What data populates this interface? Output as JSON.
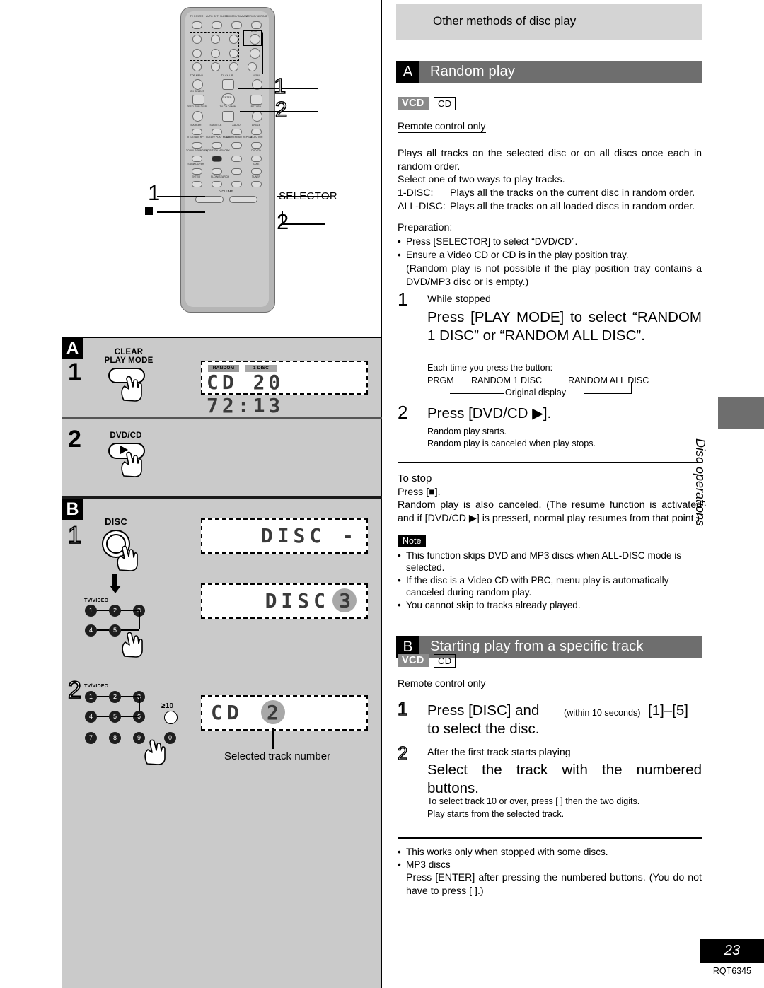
{
  "page": {
    "number": "23",
    "doc_code": "RQT6345",
    "side_tab_label": "Disc operations"
  },
  "right": {
    "banner": "Other methods of disc play",
    "section_a": {
      "letter": "A",
      "title": "Random play",
      "badges": {
        "vcd": "VCD",
        "cd": "CD"
      },
      "remote_only": "Remote control only",
      "intro1": "Plays all tracks on the selected disc or on all discs once each in random order.",
      "intro2": "Select one of two ways to play tracks.",
      "disc1_label": "1-DISC:",
      "disc1_text": "Plays all the tracks on the current disc in random order.",
      "discall_label": "ALL-DISC:",
      "discall_text": "Plays all the tracks on all loaded discs in random order.",
      "prep_title": "Preparation:",
      "prep_b1": "Press [SELECTOR] to select “DVD/CD”.",
      "prep_b2": "Ensure a Video CD or CD is in the play position tray.",
      "prep_b2_sub": "(Random play is not possible if the play position tray contains a DVD/MP3 disc or is empty.)",
      "step1_num": "1",
      "step1_cond": "While stopped",
      "step1_main": "Press [PLAY MODE] to select “RANDOM 1 DISC” or “RANDOM ALL DISC”.",
      "step1_sub": "Each time you press the button:",
      "cycle": {
        "a": "PRGM",
        "b": "RANDOM 1 DISC",
        "c": "RANDOM ALL DISC",
        "caption": "Original display"
      },
      "step2_num": "2",
      "step2_main": "Press [DVD/CD ▶].",
      "step2_sub1": "Random play starts.",
      "step2_sub2": "Random play is canceled when play stops.",
      "tostop_title": "To stop",
      "tostop_press": "Press [■].",
      "tostop_text": "Random play is also canceled. (The resume function is activated and if [DVD/CD ▶] is pressed, normal play resumes from that point.)",
      "note_tag": "Note",
      "notes": [
        "This function skips DVD and MP3 discs when ALL-DISC mode is selected.",
        "If the disc is a Video CD with PBC, menu play is automatically canceled during random play.",
        "You cannot skip to tracks already played."
      ]
    },
    "section_b": {
      "letter": "B",
      "title": "Starting play from a specific track",
      "badges": {
        "vcd": "VCD",
        "cd": "CD"
      },
      "remote_only": "Remote control only",
      "step1_num": "1",
      "step1_a": "Press [DISC] and",
      "step1_paren": "(within 10 seconds)",
      "step1_b": "[1]–[5]",
      "step1_c": "to select the disc.",
      "step2_num": "2",
      "step2_cond": "After the first track starts playing",
      "step2_main": "Select the track with the numbered buttons.",
      "step2_sub1": "To select track 10 or over, press [      ] then the two digits.",
      "step2_sub2": "Play starts from the selected track.",
      "footer_b1": "This works only when stopped with some discs.",
      "footer_b2_title": "MP3 discs",
      "footer_b2_text": "Press [ENTER] after pressing the numbered buttons. (You do not have to press [      ].)"
    }
  },
  "left": {
    "remote": {
      "callout_1_top": "1",
      "callout_2_top": "2",
      "callout_1_mid": "1",
      "callout_selector": "SELECTOR",
      "callout_2_bottom": "2",
      "top_row_labels": [
        "TV POWER",
        "AUTO OFF/ SLEEP",
        "MIX 2CH/ DIMMER",
        "ACTION/ MUTING"
      ],
      "disc_label": "DISC",
      "ten_label": "≥10",
      "numbers": [
        "1",
        "2",
        "3",
        "4",
        "5",
        "6",
        "7",
        "8",
        "9",
        "0"
      ],
      "nav_labels": [
        "TOP MENU",
        "TV CH UP",
        "MENU",
        "CH SELECT",
        "ENTER",
        "RETURN",
        "TEST/ SUR DISP",
        "TV CH DOWN"
      ],
      "fn_labels": [
        "MARKER",
        "SUBTITLE",
        "AUDIO",
        "ANGLE",
        "TITLE/ A-B RPT",
        "CLEAR/ PLAY MODE",
        "A-B REPEAT/ REPEAT",
        "SELECTOR"
      ],
      "bottom_labels": [
        "TO AV/ SOUND EQ",
        "POSITION MEMORY",
        "DVD/CD",
        "SUBWOOFER",
        "TAPE",
        "ENTER",
        "SLOW/SEARCH",
        "TUNER",
        "VOLUME"
      ]
    },
    "panel_a": {
      "tag": "A",
      "step1_num": "1",
      "step1_key_line1": "CLEAR",
      "step1_key_line2": "PLAY MODE",
      "display": {
        "ind1": "RANDOM",
        "ind2": "1 DISC",
        "text": "CD  20   72:13"
      },
      "step2_num": "2",
      "step2_key": "DVD/CD"
    },
    "panel_b": {
      "tag": "B",
      "step1_num": "1",
      "step1_key": "DISC",
      "display1": "DISC -",
      "display2_prefix": "DISC",
      "display2_value": "3",
      "tvvideo_label": "TV/VIDEO",
      "keypad": [
        "1",
        "2",
        "3",
        "4",
        "5",
        "6",
        "7",
        "8",
        "9",
        "0"
      ],
      "ten_label": "≥10",
      "step2_num": "2",
      "display3_prefix": "CD",
      "display3_value": "2",
      "caption": "Selected track number"
    }
  }
}
